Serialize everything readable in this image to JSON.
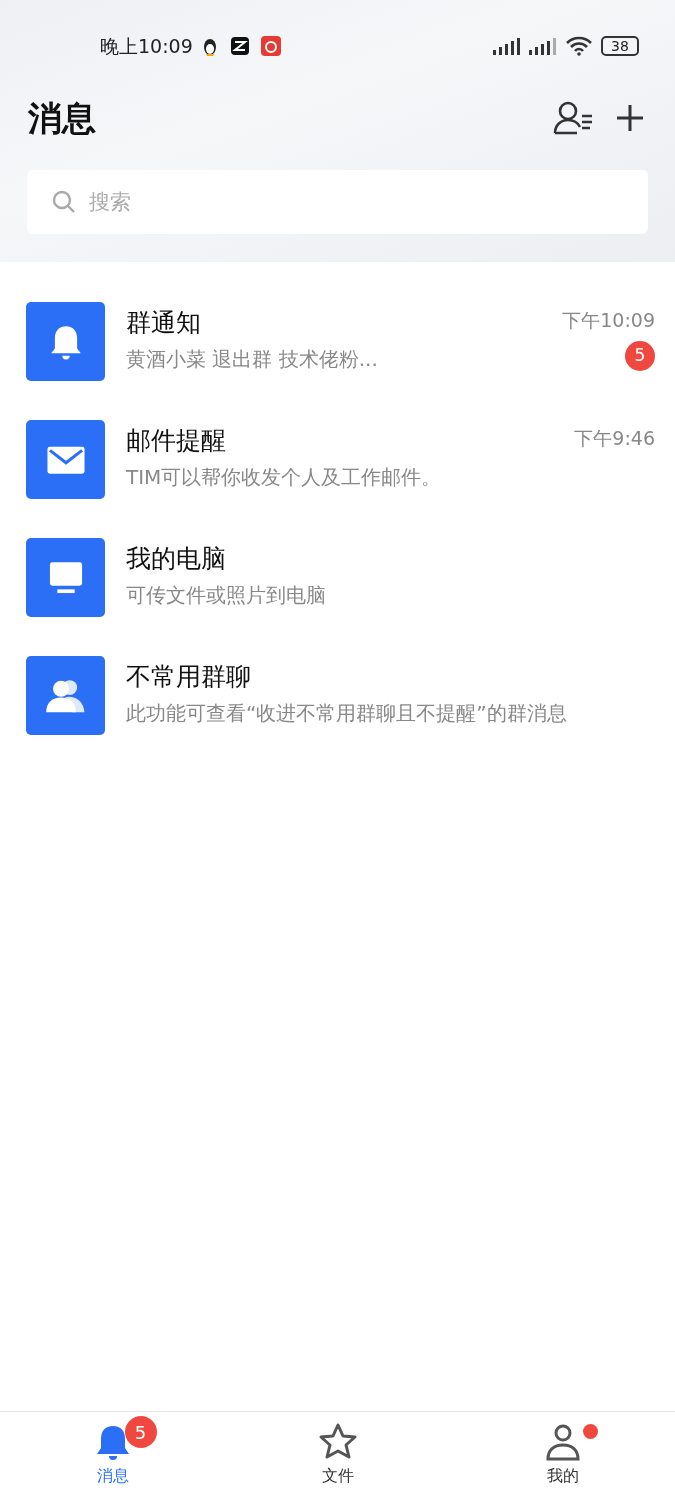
{
  "status_bar": {
    "time": "晚上10:09",
    "battery": "38"
  },
  "header": {
    "title": "消息"
  },
  "search": {
    "placeholder": "搜索"
  },
  "conversations": [
    {
      "kind": "bell",
      "title": "群通知",
      "preview": "黄酒小菜 退出群 技术佬粉...",
      "time": "下午10:09",
      "unread": "5"
    },
    {
      "kind": "mail",
      "title": "邮件提醒",
      "preview": "TIM可以帮你收发个人及工作邮件。",
      "time": "下午9:46"
    },
    {
      "kind": "computer",
      "title": "我的电脑",
      "preview": "可传文件或照片到电脑"
    },
    {
      "kind": "group",
      "title": "不常用群聊",
      "preview": "此功能可查看“收进不常用群聊且不提醒”的群消息"
    }
  ],
  "tabs": [
    {
      "kind": "bell",
      "label": "消息",
      "selected": true,
      "badge": "5",
      "dot": false
    },
    {
      "kind": "star",
      "label": "文件",
      "selected": false,
      "dot": false
    },
    {
      "kind": "person",
      "label": "我的",
      "selected": false,
      "dot": true
    }
  ]
}
